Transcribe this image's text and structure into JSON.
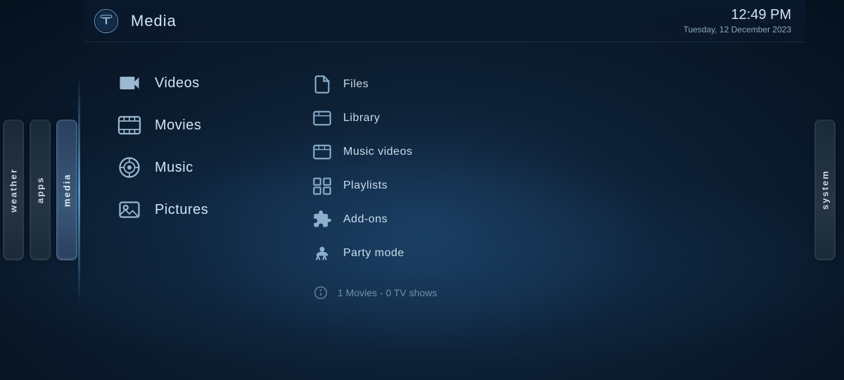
{
  "header": {
    "title": "Media",
    "time": "12:49 PM",
    "date": "Tuesday, 12 December 2023"
  },
  "sidebar": {
    "left_tabs": [
      {
        "id": "weather",
        "label": "weather"
      },
      {
        "id": "apps",
        "label": "apps"
      },
      {
        "id": "media",
        "label": "media"
      }
    ],
    "right_tab": {
      "id": "system",
      "label": "system"
    }
  },
  "main_menu": {
    "items": [
      {
        "id": "videos",
        "label": "Videos",
        "icon": "🎥"
      },
      {
        "id": "movies",
        "label": "Movies",
        "icon": "🎞"
      },
      {
        "id": "music",
        "label": "Music",
        "icon": "🎵"
      },
      {
        "id": "pictures",
        "label": "Pictures",
        "icon": "📷"
      }
    ]
  },
  "sub_menu": {
    "items": [
      {
        "id": "files",
        "label": "Files",
        "icon": "📄"
      },
      {
        "id": "library",
        "label": "Library",
        "icon": "🎬"
      },
      {
        "id": "music-videos",
        "label": "Music videos",
        "icon": "🎬"
      },
      {
        "id": "playlists",
        "label": "Playlists",
        "icon": "🎛"
      },
      {
        "id": "add-ons",
        "label": "Add-ons",
        "icon": "🧩"
      },
      {
        "id": "party-mode",
        "label": "Party mode",
        "icon": "🎭"
      }
    ],
    "info": "1 Movies  -  0 TV shows"
  }
}
